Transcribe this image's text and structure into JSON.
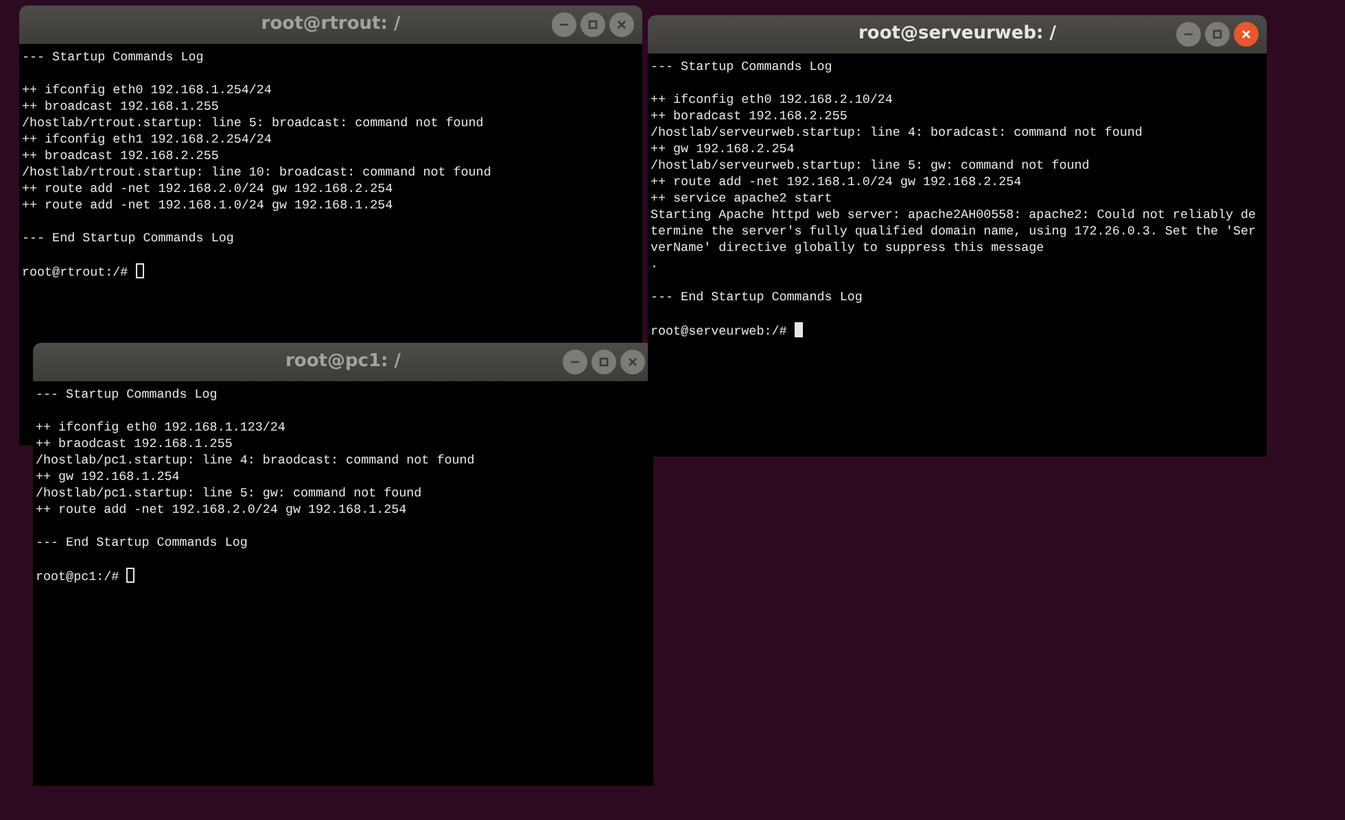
{
  "windows": [
    {
      "title": "root@rtrout: /",
      "active": false,
      "blocks": [
        [
          "--- Startup Commands Log"
        ],
        [
          "++ ifconfig eth0 192.168.1.254/24",
          "++ broadcast 192.168.1.255",
          "/hostlab/rtrout.startup: line 5: broadcast: command not found",
          "++ ifconfig eth1 192.168.2.254/24",
          "++ broadcast 192.168.2.255",
          "/hostlab/rtrout.startup: line 10: broadcast: command not found",
          "++ route add -net 192.168.2.0/24 gw 192.168.2.254",
          "++ route add -net 192.168.1.0/24 gw 192.168.1.254"
        ],
        [
          "--- End Startup Commands Log"
        ]
      ],
      "prompt": "root@rtrout:/# "
    },
    {
      "title": "root@pc1: /",
      "active": false,
      "blocks": [
        [
          "--- Startup Commands Log"
        ],
        [
          "++ ifconfig eth0 192.168.1.123/24",
          "++ braodcast 192.168.1.255",
          "/hostlab/pc1.startup: line 4: braodcast: command not found",
          "++ gw 192.168.1.254",
          "/hostlab/pc1.startup: line 5: gw: command not found",
          "++ route add -net 192.168.2.0/24 gw 192.168.1.254"
        ],
        [
          "--- End Startup Commands Log"
        ]
      ],
      "prompt": "root@pc1:/# "
    },
    {
      "title": "root@serveurweb: /",
      "active": true,
      "blocks": [
        [
          "--- Startup Commands Log"
        ],
        [
          "++ ifconfig eth0 192.168.2.10/24",
          "++ boradcast 192.168.2.255",
          "/hostlab/serveurweb.startup: line 4: boradcast: command not found",
          "++ gw 192.168.2.254",
          "/hostlab/serveurweb.startup: line 5: gw: command not found",
          "++ route add -net 192.168.1.0/24 gw 192.168.2.254",
          "++ service apache2 start",
          "Starting Apache httpd web server: apache2AH00558: apache2: Could not reliably de",
          "termine the server's fully qualified domain name, using 172.26.0.3. Set the 'Ser",
          "verName' directive globally to suppress this message",
          "."
        ],
        [
          "--- End Startup Commands Log"
        ]
      ],
      "prompt": "root@serveurweb:/# "
    }
  ]
}
